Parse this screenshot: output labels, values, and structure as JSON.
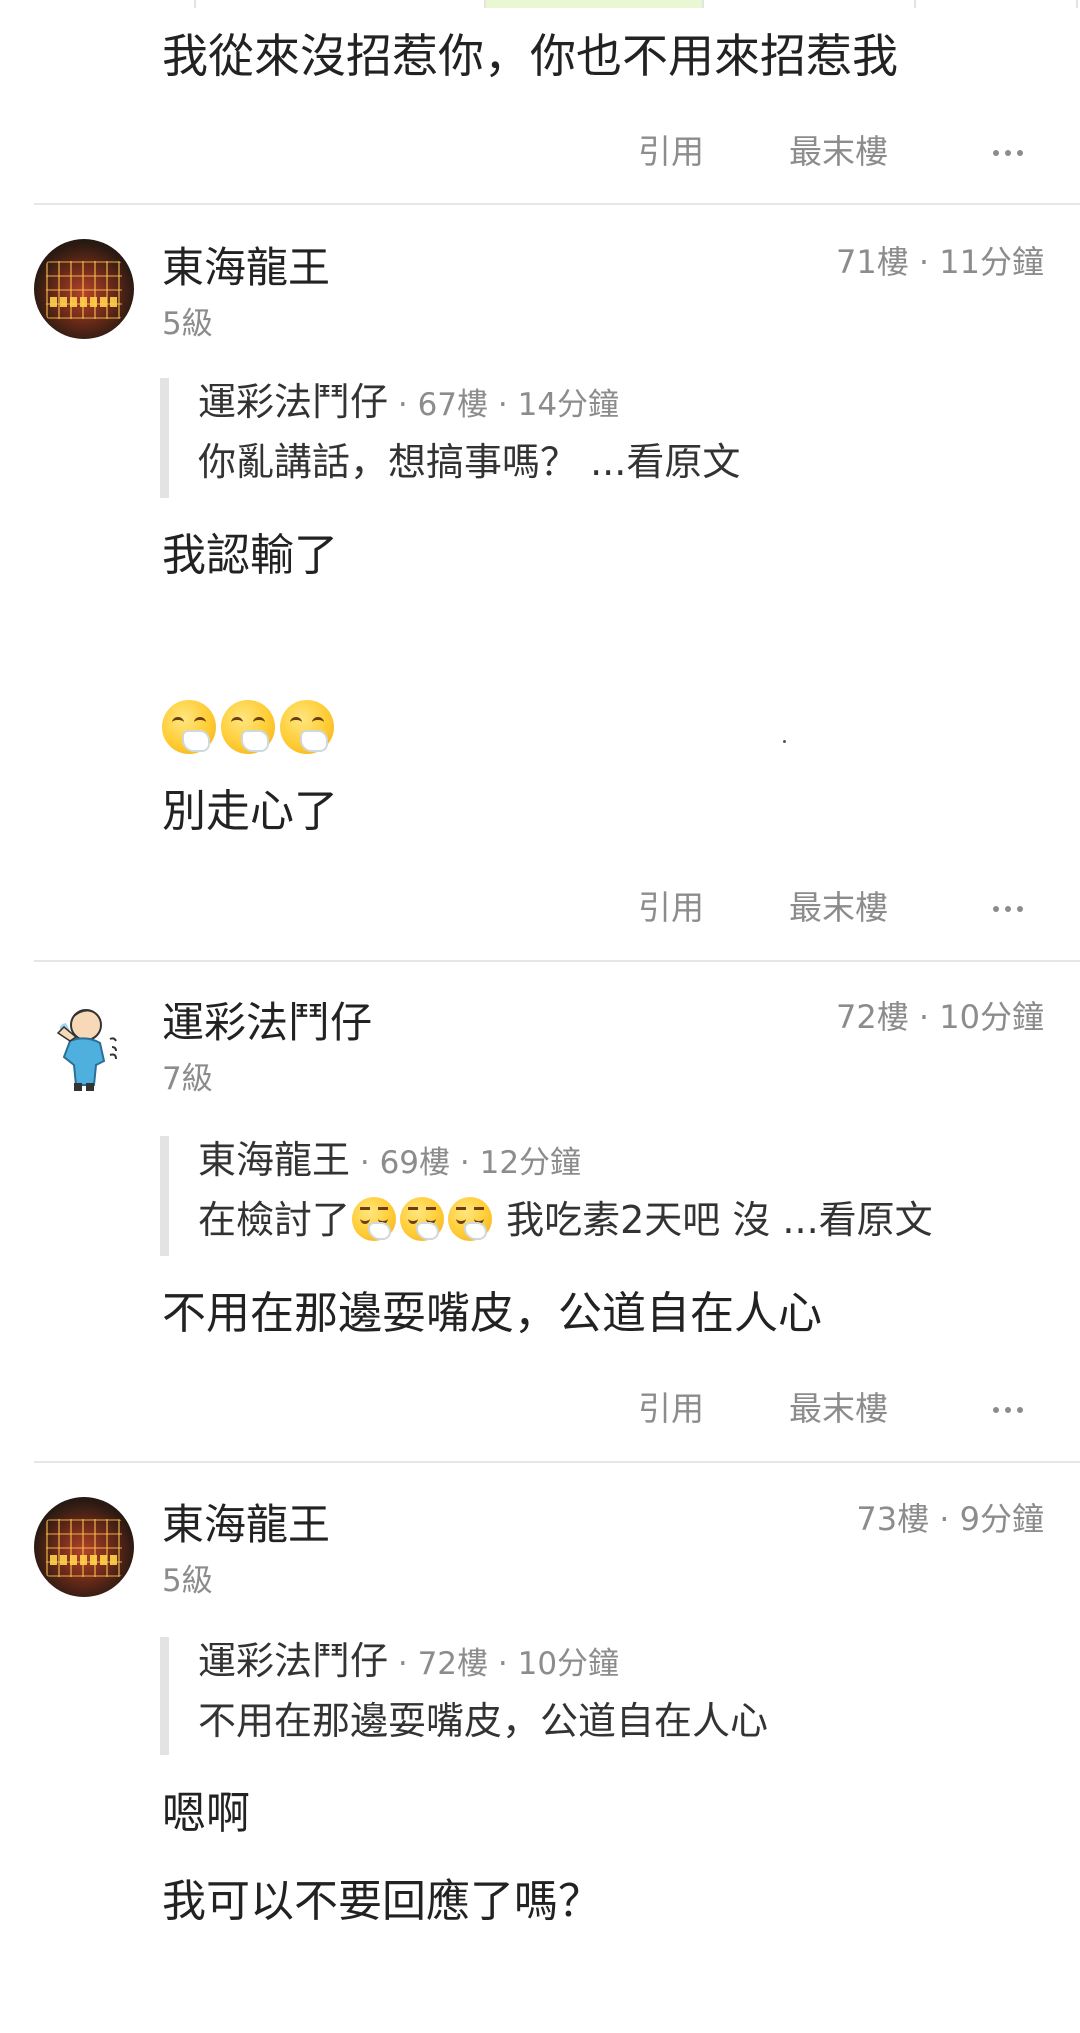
{
  "previous_post": {
    "content": "我從來沒招惹你，你也不用來招惹我",
    "actions": {
      "quote": "引用",
      "last_floor": "最末樓"
    }
  },
  "posts": [
    {
      "username": "東海龍王",
      "level": "5級",
      "floor": "71樓",
      "time": "11分鐘",
      "avatar": "dragon-slot-avatar",
      "quote": {
        "author": "運彩法鬥仔",
        "floor": "67樓",
        "time": "14分鐘",
        "text": "你亂講話，想搞事嗎？ ...看原文"
      },
      "content_lines": [
        "我認輸了",
        "別走心了"
      ],
      "emojis": [
        "sneezing-face-icon",
        "sneezing-face-icon",
        "sneezing-face-icon"
      ],
      "actions": {
        "quote": "引用",
        "last_floor": "最末樓"
      }
    },
    {
      "username": "運彩法鬥仔",
      "level": "7級",
      "floor": "72樓",
      "time": "10分鐘",
      "avatar": "cartoon-person-avatar",
      "quote": {
        "author": "東海龍王",
        "floor": "69樓",
        "time": "12分鐘",
        "text_before": "在檢討了",
        "text_after": " 我吃素2天吧 沒 ...看原文",
        "emojis": [
          "sad-sneezing-face-icon",
          "sad-sneezing-face-icon",
          "sad-sneezing-face-icon"
        ]
      },
      "content_lines": [
        "不用在那邊耍嘴皮，公道自在人心"
      ],
      "actions": {
        "quote": "引用",
        "last_floor": "最末樓"
      }
    },
    {
      "username": "東海龍王",
      "level": "5級",
      "floor": "73樓",
      "time": "9分鐘",
      "avatar": "dragon-slot-avatar",
      "quote": {
        "author": "運彩法鬥仔",
        "floor": "72樓",
        "time": "10分鐘",
        "text": "不用在那邊耍嘴皮，公道自在人心"
      },
      "content_lines": [
        "嗯啊",
        "我可以不要回應了嗎？"
      ]
    }
  ],
  "separator": " · ",
  "colors": {
    "text": "#222222",
    "muted": "#8c8c8c",
    "divider": "#e6e6e6",
    "quote_bar": "#e3e3e3",
    "active_tab": "#eaf7d3"
  }
}
